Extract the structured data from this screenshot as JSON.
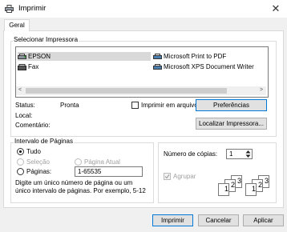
{
  "window": {
    "title": "Imprimir",
    "close_glyph": "✕"
  },
  "tabs": [
    {
      "label": "Geral"
    }
  ],
  "printer_group": {
    "label": "Selecionar Impressora",
    "printers": [
      {
        "name": "EPSON",
        "icon": "printer-icon",
        "selected": true
      },
      {
        "name": "Fax",
        "icon": "fax-icon"
      },
      {
        "name": "Microsoft Print to PDF",
        "icon": "printer-icon"
      },
      {
        "name": "Microsoft XPS Document Writer",
        "icon": "printer-icon"
      }
    ],
    "scroll_left": "<",
    "scroll_right": ">",
    "status_label": "Status:",
    "status_value": "Pronta",
    "local_label": "Local:",
    "local_value": "",
    "comment_label": "Comentário:",
    "comment_value": "",
    "print_to_file_label": "Imprimir em arquivo",
    "preferences_button": "Preferências",
    "find_printer_button": "Localizar Impressora..."
  },
  "page_range": {
    "label": "Intervalo de Páginas",
    "all_label": "Tudo",
    "selection_label": "Seleção",
    "current_page_label": "Página Atual",
    "pages_label": "Páginas:",
    "pages_value": "1-65535",
    "help_text": "Digite um único número de página ou um único intervalo de páginas. Por exemplo, 5-12"
  },
  "copies": {
    "label": "Número de cópias:",
    "value": "1",
    "collate_label": "Agrupar"
  },
  "collate_digits": [
    "1",
    "2",
    "3"
  ],
  "buttons": {
    "print": "Imprimir",
    "cancel": "Cancelar",
    "apply": "Aplicar"
  }
}
